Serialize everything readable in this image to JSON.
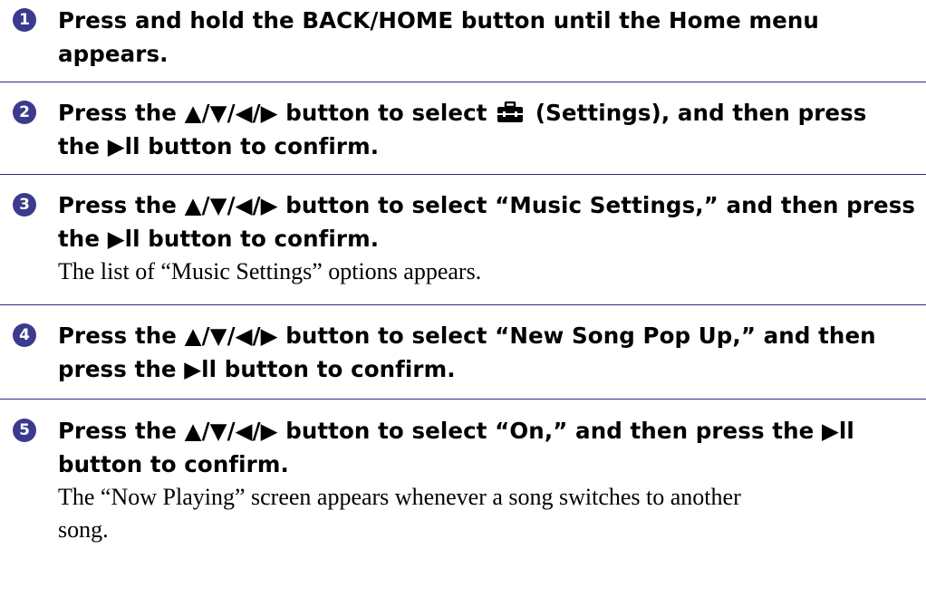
{
  "steps": [
    {
      "number": "1",
      "instruction_l1": "Press and hold the BACK/HOME button until the Home menu",
      "instruction_l2": "appears."
    },
    {
      "number": "2",
      "instruction_l1_a": "Press the ▲/▼/◀/▶ button to select",
      "settings_icon": "toolbox-settings-icon",
      "instruction_l1_b": "(Settings), and then press",
      "instruction_l2": "the ▶ll button to confirm."
    },
    {
      "number": "3",
      "instruction_l1": "Press the ▲/▼/◀/▶ button to select “Music Settings,” and then press",
      "instruction_l2": "the ▶ll button to confirm.",
      "result": "The list of “Music Settings” options appears."
    },
    {
      "number": "4",
      "instruction_l1": "Press the ▲/▼/◀/▶ button to select “New Song Pop Up,” and then",
      "instruction_l2": "press the ▶ll button to confirm."
    },
    {
      "number": "5",
      "instruction_l1": "Press the ▲/▼/◀/▶ button to select “On,” and then press the ▶ll",
      "instruction_l2": "button to confirm.",
      "result_l1": "The “Now Playing” screen appears whenever a song switches to another",
      "result_l2": "song."
    }
  ],
  "colors": {
    "badge": "#3a3a8e",
    "divider": "#2c2a7a"
  }
}
